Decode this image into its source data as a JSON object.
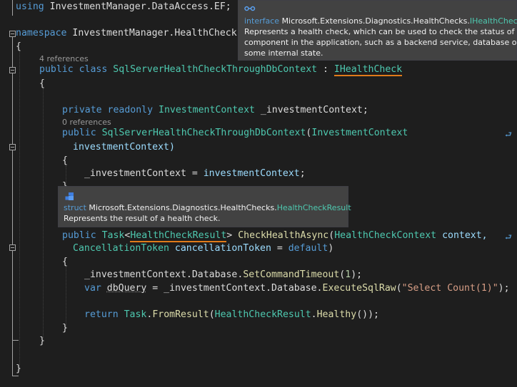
{
  "code": {
    "using_kw": "using",
    "using_ns": "InvestmentManager.DataAccess.EF;",
    "ns_kw": "namespace",
    "ns_name": "InvestmentManager.HealthCheck",
    "brace_open": "{",
    "brace_close": "}",
    "lens_class": "4 references",
    "class_public": "public",
    "class_kw": "class",
    "class_name": "SqlServerHealthCheckThroughDbContext",
    "class_colon": " : ",
    "class_base": "IHealthCheck",
    "field_mods": "private readonly",
    "field_type": "InvestmentContext",
    "field_name": " _investmentContext;",
    "lens_ctor": "0 references",
    "ctor_public": "public",
    "ctor_name": "SqlServerHealthCheckThroughDbContext",
    "ctor_paren": "(",
    "ctor_ptype": "InvestmentContext",
    "ctor_pname": "investmentContext)",
    "assign_left": "_investmentContext = ",
    "assign_right": "investmentContext",
    "assign_end": ";",
    "m_public": "public",
    "m_task": "Task",
    "m_lt": "<",
    "m_result": "HealthCheckResult",
    "m_gt": ">",
    "m_name": "CheckHealthAsync",
    "m_paren": "(",
    "m_ctx_type": "HealthCheckContext",
    "m_ctx_name": " context,",
    "m_ct_type": "CancellationToken",
    "m_ct_name": " cancellationToken",
    "m_ct_eq": " = ",
    "m_ct_default": "default",
    "m_ct_close": ")",
    "s1_pre": "_investmentContext.Database.",
    "s1_fn": "SetCommandTimeout",
    "s1_open": "(",
    "s1_num": "1",
    "s1_close": ");",
    "s2_var": "var",
    "s2_name": "dbQuery",
    "s2_mid": " = _investmentContext.Database.",
    "s2_fn": "ExecuteSqlRaw",
    "s2_open": "(",
    "s2_str": "\"Select Count(1)\"",
    "s2_close": ");",
    "ret_kw": "return",
    "ret_task": "Task",
    "ret_dot": ".",
    "ret_fn": "FromResult",
    "ret_open": "(",
    "ret_type": "HealthCheckResult",
    "ret_dot2": ".",
    "ret_fn2": "Healthy",
    "ret_close": "());"
  },
  "tooltip_interface": {
    "icon": "interface-icon",
    "kind": "interface",
    "namespace": "Microsoft.Extensions.Diagnostics.HealthChecks.",
    "type": "IHealthCheck",
    "desc1": "Represents a health check, which can be used to check the status of a",
    "desc2": "component in the application, such as a backend service, database or",
    "desc3": "some internal state."
  },
  "tooltip_struct": {
    "icon": "struct-icon",
    "kind": "struct",
    "namespace": "Microsoft.Extensions.Diagnostics.HealthChecks.",
    "type": "HealthCheckResult",
    "desc": "Represents the result of a health check."
  },
  "colors": {
    "background": "#1e1e1e",
    "keyword": "#569cd6",
    "type": "#4ec9b0",
    "method": "#dcdcaa",
    "string": "#d69d85",
    "parameter": "#9cdcfe",
    "highlight_underline": "#e07b19"
  }
}
